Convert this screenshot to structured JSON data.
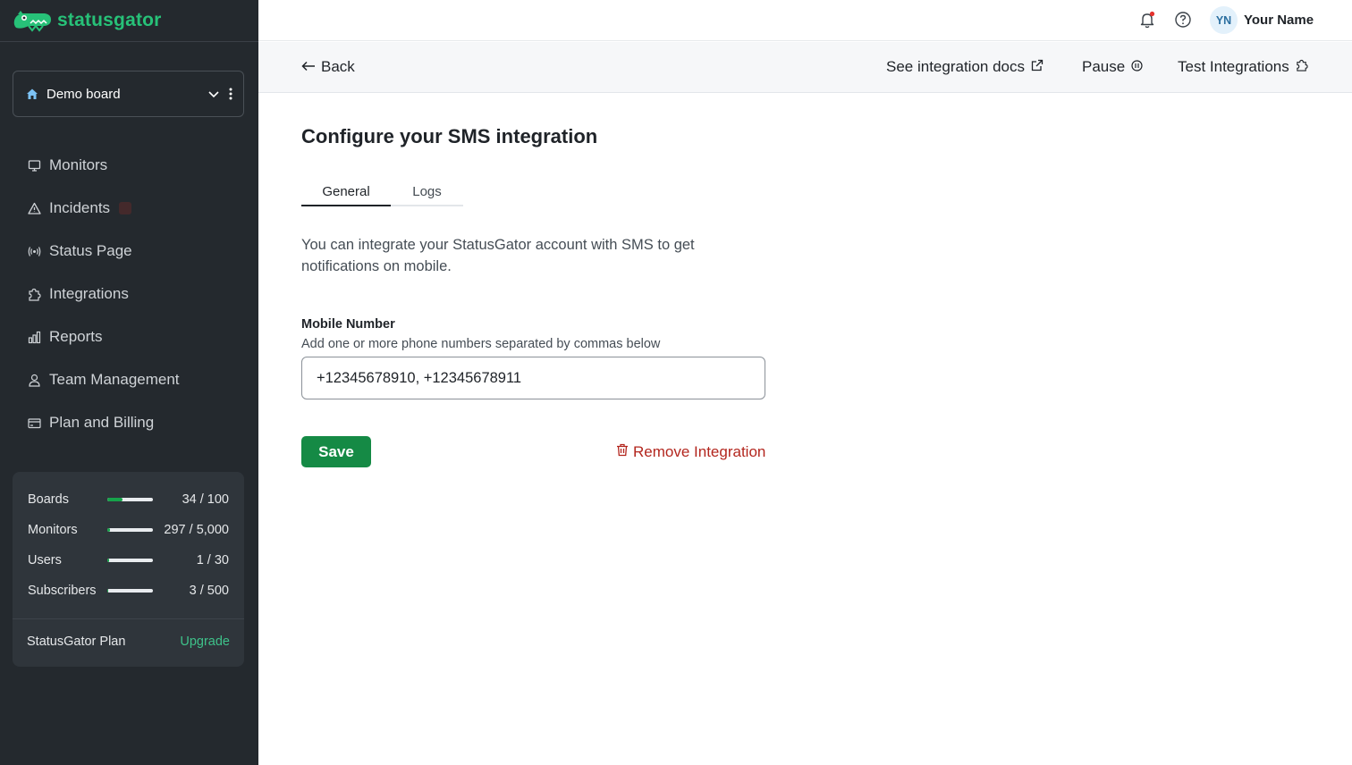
{
  "app": {
    "name": "statusgator"
  },
  "sidebar": {
    "board": {
      "label": "Demo board"
    },
    "nav": [
      {
        "label": "Monitors",
        "icon": "monitor-icon"
      },
      {
        "label": "Incidents",
        "icon": "warning-icon"
      },
      {
        "label": "Status Page",
        "icon": "broadcast-icon"
      },
      {
        "label": "Integrations",
        "icon": "puzzle-icon"
      },
      {
        "label": "Reports",
        "icon": "bar-chart-icon"
      },
      {
        "label": "Team Management",
        "icon": "user-icon"
      },
      {
        "label": "Plan and Billing",
        "icon": "credit-card-icon"
      }
    ],
    "usage": [
      {
        "label": "Boards",
        "value": "34 / 100",
        "fraction": 0.34
      },
      {
        "label": "Monitors",
        "value": "297 / 5,000",
        "fraction": 0.06
      },
      {
        "label": "Users",
        "value": "1 / 30",
        "fraction": 0.03
      },
      {
        "label": "Subscribers",
        "value": "3 / 500",
        "fraction": 0.006
      }
    ],
    "plan": {
      "label": "StatusGator Plan",
      "upgrade": "Upgrade"
    }
  },
  "header": {
    "user": {
      "initials": "YN",
      "name": "Your Name"
    }
  },
  "subheader": {
    "back": "Back",
    "docs": "See integration docs",
    "pause": "Pause",
    "test": "Test Integrations"
  },
  "main": {
    "title": "Configure your SMS integration",
    "tabs": [
      {
        "label": "General"
      },
      {
        "label": "Logs"
      }
    ],
    "description": "You can integrate your StatusGator account with SMS to get notifications on mobile.",
    "field": {
      "label": "Mobile Number",
      "help": "Add one or more phone numbers separated by commas below",
      "value": "+12345678910, +12345678911"
    },
    "save": "Save",
    "remove": "Remove Integration"
  },
  "colors": {
    "sidebar_bg": "#24292e",
    "accent": "#158a45",
    "danger": "#b3261e",
    "brand": "#27c178"
  }
}
